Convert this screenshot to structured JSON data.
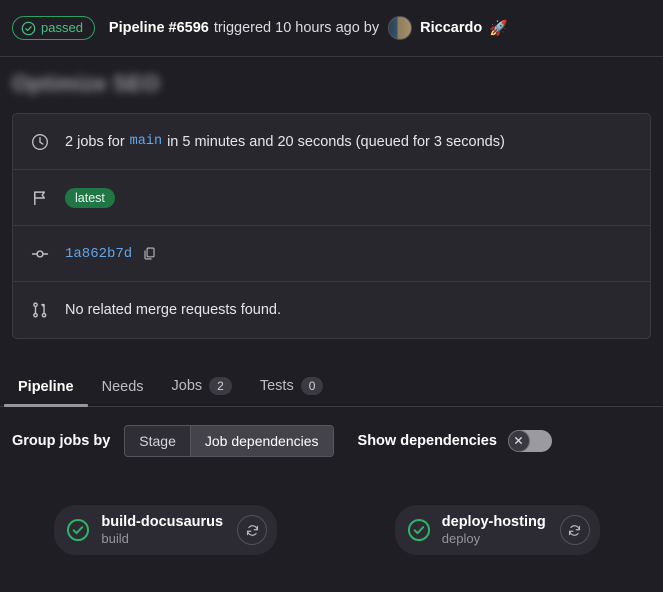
{
  "header": {
    "status": "passed",
    "status_icon": "check-circle-icon",
    "pipeline_label": "Pipeline #6596",
    "triggered_text": "triggered 10 hours ago by",
    "user": "Riccardo",
    "emoji": "🚀",
    "status_color": "#4cc185"
  },
  "title": "Optimize SEO",
  "info": {
    "jobs_prefix": "2 jobs for",
    "ref": "main",
    "duration_text": "in 5 minutes and 20 seconds (queued for 3 seconds)",
    "tag": "latest",
    "commit_sha": "1a862b7d",
    "merge_requests": "No related merge requests found."
  },
  "tabs": [
    {
      "label": "Pipeline",
      "count": null,
      "active": true
    },
    {
      "label": "Needs",
      "count": null,
      "active": false
    },
    {
      "label": "Jobs",
      "count": "2",
      "active": false
    },
    {
      "label": "Tests",
      "count": "0",
      "active": false
    }
  ],
  "controls": {
    "group_label": "Group jobs by",
    "segment_stage": "Stage",
    "segment_dependencies": "Job dependencies",
    "show_dependencies_label": "Show dependencies",
    "toggle_on": false
  },
  "jobs": [
    {
      "name": "build-docusaurus",
      "stage": "build",
      "status": "passed"
    },
    {
      "name": "deploy-hosting",
      "stage": "deploy",
      "status": "passed"
    }
  ]
}
